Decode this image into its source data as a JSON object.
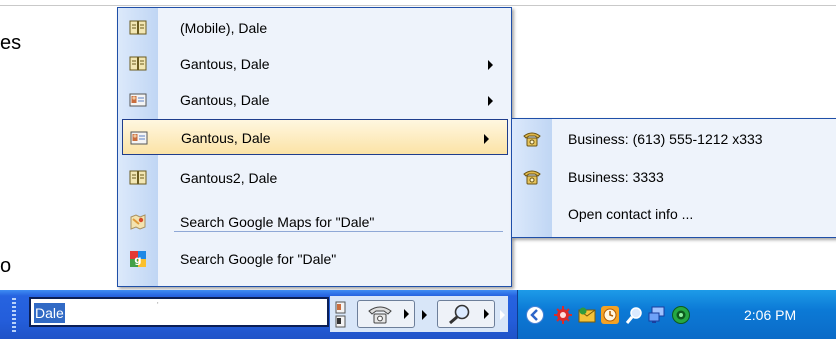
{
  "background": {
    "fragment_top": "es",
    "fragment_bottom": "o"
  },
  "menu": {
    "items": [
      {
        "label": "(Mobile), Dale",
        "icon": "address-book-icon",
        "submenu": false
      },
      {
        "label": "Gantous, Dale",
        "icon": "address-book-icon",
        "submenu": true
      },
      {
        "label": "Gantous, Dale",
        "icon": "contact-card-icon",
        "submenu": true
      },
      {
        "label": "Gantous, Dale",
        "icon": "contact-card-icon",
        "submenu": true,
        "selected": true
      },
      {
        "label": "Gantous2, Dale",
        "icon": "address-book-icon",
        "submenu": false
      },
      {
        "label": "Search Google Maps for \"Dale\"",
        "icon": "google-maps-icon",
        "submenu": false
      },
      {
        "label": "Search Google for \"Dale\"",
        "icon": "google-icon",
        "submenu": false
      }
    ]
  },
  "submenu": {
    "items": [
      {
        "label": "Business: (613) 555-1212 x333",
        "icon": "phone-icon"
      },
      {
        "label": "Business: 3333",
        "icon": "phone-icon"
      },
      {
        "label": "Open contact info ...",
        "icon": ""
      }
    ]
  },
  "taskbar": {
    "search_value": "Dale",
    "clock": "2:06 PM",
    "tray_icons": [
      "show-hidden-icon",
      "network-icon",
      "messenger-icon",
      "clock-icon",
      "search-icon",
      "display-icon",
      "security-icon"
    ]
  },
  "colors": {
    "menu_border": "#1f4fa8",
    "selection_fill": "#fbe3a6",
    "taskbar_blue": "#245edb",
    "tray_blue": "#0c7ad6"
  }
}
